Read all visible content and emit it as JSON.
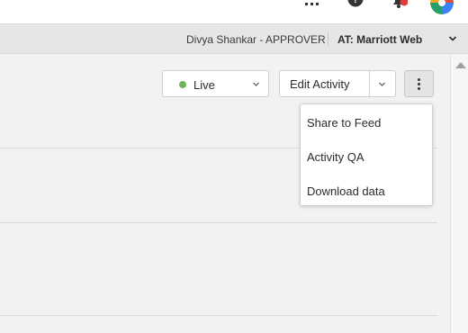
{
  "header": {
    "user": "Divya Shankar - APPROVER",
    "account": "AT: Marriott Web"
  },
  "actions": {
    "status_label": "Live",
    "status_color": "#6cb552",
    "edit_label": "Edit Activity"
  },
  "menu": {
    "items": [
      {
        "label": "Share to Feed"
      },
      {
        "label": "Activity QA"
      },
      {
        "label": "Download data"
      }
    ]
  },
  "icons": {
    "apps": "grid-icon",
    "help": "help-icon",
    "notifications": "bell-icon",
    "more": "more-vertical-icon"
  },
  "colors": {
    "notification_badge": "#e03a3a"
  }
}
